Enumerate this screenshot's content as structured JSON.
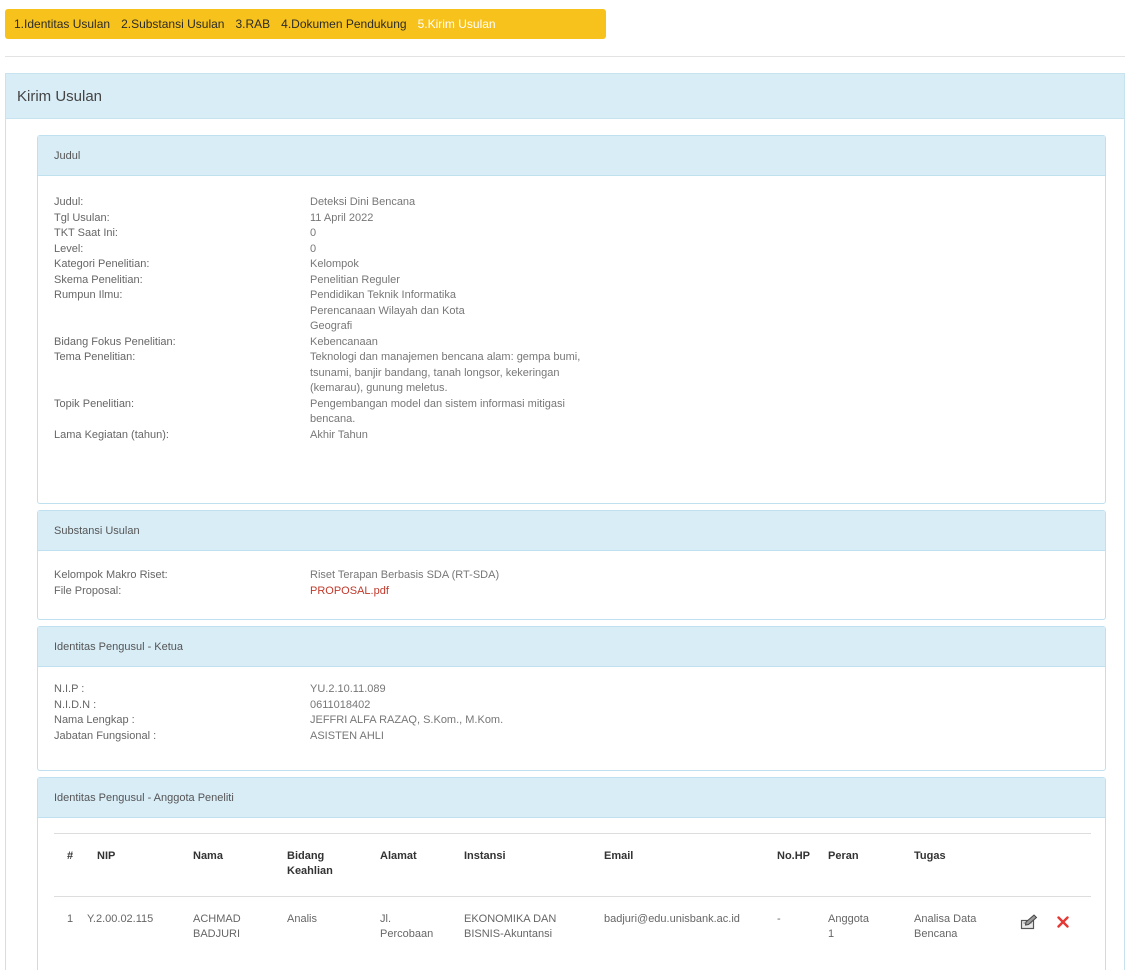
{
  "tabs": [
    {
      "label": "1.Identitas Usulan"
    },
    {
      "label": "2.Substansi Usulan"
    },
    {
      "label": "3.RAB"
    },
    {
      "label": "4.Dokumen Pendukung"
    },
    {
      "label": "5.Kirim Usulan"
    }
  ],
  "page_title": "Kirim Usulan",
  "judul": {
    "header": "Judul",
    "rows": [
      {
        "key": "Judul:",
        "lines": [
          "Deteksi Dini Bencana"
        ]
      },
      {
        "key": "Tgl Usulan:",
        "lines": [
          "11 April 2022"
        ]
      },
      {
        "key": "TKT Saat Ini:",
        "lines": [
          "0"
        ]
      },
      {
        "key": "Level:",
        "lines": [
          "0"
        ]
      },
      {
        "key": "Kategori Penelitian:",
        "lines": [
          "Kelompok"
        ]
      },
      {
        "key": "Skema Penelitian:",
        "lines": [
          "Penelitian Reguler"
        ]
      },
      {
        "key": "Rumpun Ilmu:",
        "lines": [
          "Pendidikan Teknik Informatika",
          "Perencanaan Wilayah dan Kota",
          "Geografi"
        ]
      },
      {
        "key": "Bidang Fokus Penelitian:",
        "lines": [
          "Kebencanaan"
        ]
      },
      {
        "key": "Tema Penelitian:",
        "lines": [
          "Teknologi dan manajemen bencana alam: gempa bumi,",
          "tsunami, banjir bandang, tanah longsor, kekeringan",
          "(kemarau), gunung meletus."
        ]
      },
      {
        "key": "Topik Penelitian:",
        "lines": [
          "Pengembangan model dan sistem informasi mitigasi",
          "bencana."
        ]
      },
      {
        "key": "Lama Kegiatan (tahun):",
        "lines": [
          "Akhir Tahun"
        ]
      }
    ]
  },
  "substansi": {
    "header": "Substansi Usulan",
    "rows": [
      {
        "key": "Kelompok Makro Riset:",
        "value": "Riset Terapan Berbasis SDA (RT-SDA)"
      },
      {
        "key": "File Proposal:",
        "value": "PROPOSAL.pdf"
      }
    ]
  },
  "ketua": {
    "header": "Identitas Pengusul - Ketua",
    "rows": [
      {
        "key": "N.I.P :",
        "value": "YU.2.10.11.089"
      },
      {
        "key": "N.I.D.N :",
        "value": "0611018402"
      },
      {
        "key": "Nama Lengkap :",
        "value": "JEFFRI ALFA RAZAQ, S.Kom., M.Kom."
      },
      {
        "key": "Jabatan Fungsional :",
        "value": "ASISTEN AHLI"
      }
    ]
  },
  "anggota": {
    "header": "Identitas Pengusul - Anggota Peneliti",
    "columns": {
      "no": "#",
      "nip": "NIP",
      "nama": "Nama",
      "bidang": [
        "Bidang",
        "Keahlian"
      ],
      "alamat": "Alamat",
      "instansi": "Instansi",
      "email": "Email",
      "hp": "No.HP",
      "peran": "Peran",
      "tugas": "Tugas"
    },
    "rows": [
      {
        "no": "1",
        "nip": "Y.2.00.02.115",
        "nama": [
          "ACHMAD",
          "BADJURI"
        ],
        "bidang": "Analis",
        "alamat": [
          "Jl.",
          "Percobaan"
        ],
        "instansi": [
          "EKONOMIKA DAN",
          "BISNIS-Akuntansi"
        ],
        "email": "badjuri@edu.unisbank.ac.id",
        "hp": "-",
        "peran": [
          "Anggota",
          "1"
        ],
        "tugas": [
          "Analisa Data",
          "Bencana"
        ]
      }
    ]
  },
  "icons": {
    "edit": "edit-icon",
    "delete": "delete-icon",
    "delete_color": "#e53935"
  },
  "colors": {
    "tab_bar": "#f7c21b",
    "panel_header": "#d9edf7",
    "link": "#c0392b"
  }
}
